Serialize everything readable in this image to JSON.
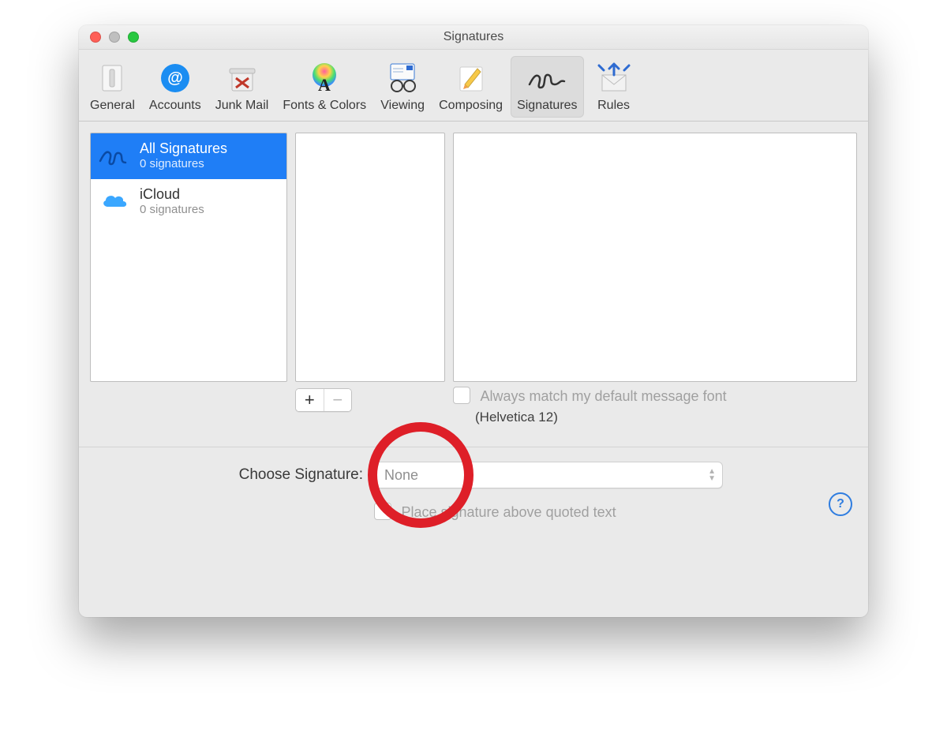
{
  "window": {
    "title": "Signatures"
  },
  "toolbar": {
    "items": [
      {
        "id": "general",
        "label": "General"
      },
      {
        "id": "accounts",
        "label": "Accounts"
      },
      {
        "id": "junk-mail",
        "label": "Junk Mail"
      },
      {
        "id": "fonts-colors",
        "label": "Fonts & Colors"
      },
      {
        "id": "viewing",
        "label": "Viewing"
      },
      {
        "id": "composing",
        "label": "Composing"
      },
      {
        "id": "signatures",
        "label": "Signatures",
        "selected": true
      },
      {
        "id": "rules",
        "label": "Rules"
      }
    ]
  },
  "accounts": [
    {
      "id": "all",
      "title": "All Signatures",
      "subtitle": "0 signatures",
      "selected": true
    },
    {
      "id": "icloud",
      "title": "iCloud",
      "subtitle": "0 signatures"
    }
  ],
  "options": {
    "match_font_label": "Always match my default message font",
    "match_font_checked": false,
    "default_font": "(Helvetica 12)"
  },
  "bottom": {
    "choose_label": "Choose Signature:",
    "choose_value": "None",
    "place_above_label": "Place signature above quoted text",
    "place_above_checked": false
  },
  "annotation": {
    "highlight": "add-signature-button",
    "color": "#de1f28"
  }
}
